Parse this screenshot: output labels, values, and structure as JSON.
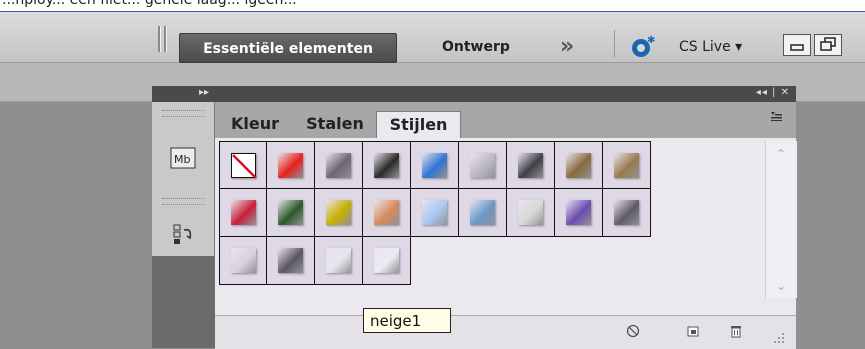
{
  "page_top_text": "...nploy... een filet... gehele laag... lgeen...",
  "appbar": {
    "workspace_button": "Essentiële elementen",
    "workspace_link": "Ontwerp",
    "more_glyph": "»",
    "cslive_label": "CS Live ▾"
  },
  "panel": {
    "expand_glyph": "▸▸",
    "collapse_glyphs": "◂◂ | ✕",
    "tabs": [
      "Kleur",
      "Stalen",
      "Stijlen"
    ],
    "active_tab": "Stijlen",
    "tooltip": "neige1",
    "styles": [
      {
        "name": "none-style"
      },
      {
        "name": "red-glow-style",
        "color": "#e8201a"
      },
      {
        "name": "gray-outline-style",
        "color": "#6b6670"
      },
      {
        "name": "dark-ring-style",
        "color": "#2a2a2a"
      },
      {
        "name": "blue-gloss-style",
        "color": "#2f74d2"
      },
      {
        "name": "light-gray-style",
        "color": "#bdb9c4"
      },
      {
        "name": "dark-gradient-style",
        "color": "#3f3f46"
      },
      {
        "name": "brown-style",
        "color": "#8a6a3c"
      },
      {
        "name": "bronze-style",
        "color": "#9a7a4c"
      },
      {
        "name": "red-stripe-style",
        "color": "#c8203a"
      },
      {
        "name": "green-black-style",
        "color": "#2a5a2a"
      },
      {
        "name": "gold-style",
        "color": "#c8b000"
      },
      {
        "name": "peach-style",
        "color": "#d88a5a"
      },
      {
        "name": "light-blue-style",
        "color": "#a8c8f0"
      },
      {
        "name": "sky-horizon-style",
        "color": "#6a98c8"
      },
      {
        "name": "white-texture-style",
        "color": "#d8d8d8"
      },
      {
        "name": "purple-gradient-style",
        "color": "#6a4cb0"
      },
      {
        "name": "gray-square-style",
        "color": "#5e5a66"
      },
      {
        "name": "lilac-style",
        "color": "#d8d2e2"
      },
      {
        "name": "dark-gray-style",
        "color": "#5b5762"
      },
      {
        "name": "neige-style",
        "color": "#e6e4ec"
      },
      {
        "name": "neige1-style",
        "color": "#ecebf2"
      }
    ]
  }
}
